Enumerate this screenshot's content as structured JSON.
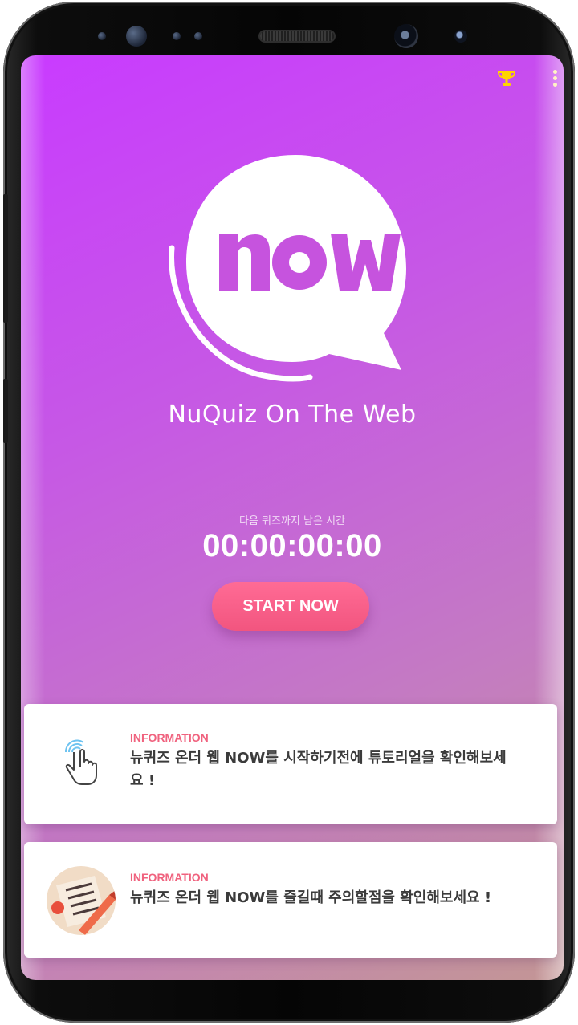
{
  "app": {
    "tagline": "NuQuiz On The Web",
    "logo_text": "now"
  },
  "header": {
    "trophy_icon": "trophy-icon",
    "menu_icon": "more-vertical-icon"
  },
  "countdown": {
    "label": "다음 퀴즈까지 남은 시간",
    "value": "00:00:00:00"
  },
  "start_button": {
    "label": "START NOW"
  },
  "cards": [
    {
      "kicker": "INFORMATION",
      "message": "뉴퀴즈 온더 웹 NOW를 시작하기전에 튜토리얼을 확인해보세요 !",
      "icon": "tap-hand-icon"
    },
    {
      "kicker": "INFORMATION",
      "message": "뉴퀴즈 온더 웹 NOW를 즐길때 주의할점을 확인해보세요 !",
      "icon": "checklist-pencil-icon"
    }
  ],
  "colors": {
    "gradient_start": "#c93bff",
    "gradient_end": "#c39695",
    "button": "#f2557f",
    "kicker": "#f0627e",
    "trophy": "#ffd400"
  }
}
